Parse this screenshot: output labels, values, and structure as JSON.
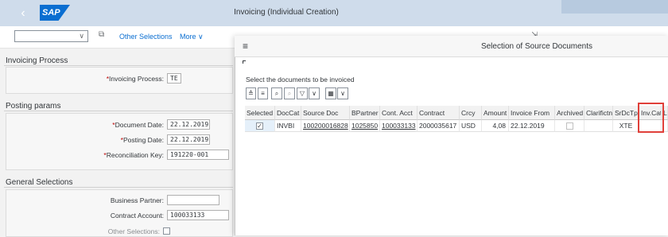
{
  "shell": {
    "logo": "SAP",
    "title": "Invoicing (Individual Creation)",
    "back_glyph": "‹"
  },
  "toolbar": {
    "variant_value": "",
    "other_selections": "Other Selections",
    "more": "More ∨"
  },
  "invoicing_process": {
    "title": "Invoicing Process",
    "label": "Invoicing Process:",
    "value": "TE"
  },
  "posting_params": {
    "title": "Posting params",
    "document_date_label": "Document Date:",
    "document_date": "22.12.2019",
    "posting_date_label": "Posting Date:",
    "posting_date": "22.12.2019",
    "recon_key_label": "Reconciliation Key:",
    "recon_key": "191220-001"
  },
  "general_selections": {
    "title": "General Selections",
    "business_partner_label": "Business Partner:",
    "business_partner": "",
    "contract_account_label": "Contract Account:",
    "contract_account": "100033133",
    "other_selections_label": "Other Selections:"
  },
  "dialog": {
    "title": "Selection of Source Documents",
    "instruction": "Select the documents to be invoiced",
    "columns": [
      "Selected",
      "DocCat",
      "Source Doc",
      "BPartner",
      "Cont. Acct",
      "Contract",
      "Crcy",
      "Amount",
      "Invoice From",
      "Archived",
      "Clarifictn",
      "SrDcTp",
      "Inv.Cat",
      "Lo"
    ],
    "rows": [
      {
        "selected": true,
        "doccat": "INVBI",
        "source_doc": "100200016828",
        "bpartner": "1025850",
        "cont_acct": "100033133",
        "contract": "2000035617",
        "crcy": "USD",
        "amount": "4,08",
        "invoice_from": "22.12.2019",
        "archived": false,
        "clarifictn": "",
        "srdctp": "XTE",
        "inv_cat": "",
        "lo": ""
      }
    ]
  },
  "colors": {
    "accent": "#0a6ed1",
    "highlight": "#e0403a",
    "shell": "#cfdceb"
  }
}
